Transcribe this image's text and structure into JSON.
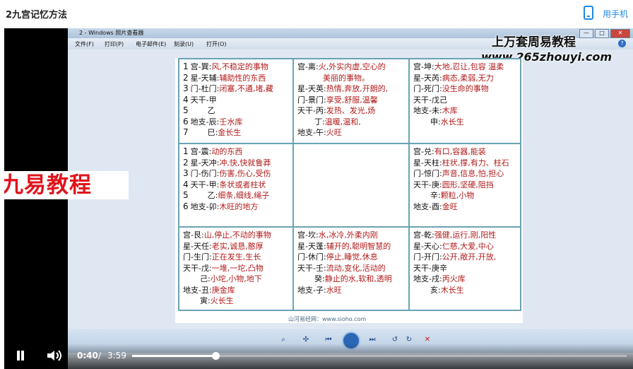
{
  "page": {
    "title": "2九宫记忆方法",
    "use_phone": "用手机"
  },
  "viewer": {
    "window_title": "2 - Windows 照片查看器",
    "menu": [
      "文件(F)",
      "打印(P)",
      "电子邮件(E)",
      "刻录(U)",
      "打开(O)"
    ],
    "controls": [
      "—",
      "□",
      "✕"
    ]
  },
  "watermark": {
    "title": "上万套周易教程",
    "url": "www.265zhouyi.com"
  },
  "brand": "九易教程",
  "doc_footer": "山河易经网：www.sioho.com",
  "palaces": [
    {
      "id": "xun",
      "lines": [
        {
          "n": "1",
          "k": "宫-巽",
          "v": "风,不稳定的事物"
        },
        {
          "n": "2",
          "k": "星-天辅",
          "v": "辅助性的东西"
        },
        {
          "n": "3",
          "k": "门-杜门",
          "v": "闭塞,不通,堵,藏"
        },
        {
          "n": "4",
          "k": "天干-甲",
          "v": ""
        },
        {
          "n": "5",
          "k": "乙",
          "v": ""
        },
        {
          "n": "6",
          "k": "地支-辰",
          "v": "壬水库"
        },
        {
          "n": "7",
          "k": "巳",
          "v": "金长生"
        }
      ]
    },
    {
      "id": "li",
      "lines": [
        {
          "n": "",
          "k": "宫-离",
          "v": "火,外实内虚,空心的"
        },
        {
          "n": "",
          "k": "",
          "v": "美丽的事物。"
        },
        {
          "n": "",
          "k": "星-天英",
          "v": "热情,奔放,开朗的,"
        },
        {
          "n": "",
          "k": "门-景门",
          "v": "享受,舒服,温馨"
        },
        {
          "n": "",
          "k": "天干-丙",
          "v": "发热、发光,炀"
        },
        {
          "n": "",
          "k": "丁",
          "v": "温暖,温和,"
        },
        {
          "n": "",
          "k": "地支-午",
          "v": "火旺"
        }
      ]
    },
    {
      "id": "kun",
      "lines": [
        {
          "n": "",
          "k": "宫-坤",
          "v": "大地,忍让,包容  温柔"
        },
        {
          "n": "",
          "k": "星-天芮",
          "v": "病态,柔弱,无力"
        },
        {
          "n": "",
          "k": "门-死门",
          "v": "没生命的事物"
        },
        {
          "n": "",
          "k": "天干-戊己",
          "v": ""
        },
        {
          "n": "",
          "k": "地支-未",
          "v": "木库"
        },
        {
          "n": "",
          "k": "申",
          "v": "水长生"
        }
      ]
    },
    {
      "id": "zhen",
      "lines": [
        {
          "n": "1",
          "k": "宫-震",
          "v": "动的东西"
        },
        {
          "n": "2",
          "k": "星-天冲",
          "v": "冲,快,快就鲁莽"
        },
        {
          "n": "3",
          "k": "门-伤门",
          "v": "伤害,伤心,受伤"
        },
        {
          "n": "4",
          "k": "天干-甲",
          "v": "条状或者柱状"
        },
        {
          "n": "5",
          "k": "乙",
          "v": "细条,细线,绳子"
        },
        {
          "n": "6",
          "k": "地支-卯",
          "v": "木旺的地方"
        }
      ]
    },
    {
      "id": "zhong",
      "lines": []
    },
    {
      "id": "dui",
      "lines": [
        {
          "n": "",
          "k": "宫-兑",
          "v": "有口,容器,能装"
        },
        {
          "n": "",
          "k": "星-天柱",
          "v": "柱状,撑,有力、柱石"
        },
        {
          "n": "",
          "k": "门-惊门",
          "v": "声音,信息,怕,担心"
        },
        {
          "n": "",
          "k": "天干-庚",
          "v": "圆形,坚硬,阻挡"
        },
        {
          "n": "",
          "k": "辛",
          "v": "颗粒,小物"
        },
        {
          "n": "",
          "k": "地支-酉",
          "v": "金旺"
        }
      ]
    },
    {
      "id": "gen",
      "lines": [
        {
          "n": "",
          "k": "宫-艮",
          "v": "山,停止,不动的事物"
        },
        {
          "n": "",
          "k": "星-天任",
          "v": "老实,诚恳,憨厚"
        },
        {
          "n": "",
          "k": "门-生门",
          "v": "正在发生,生长"
        },
        {
          "n": "",
          "k": "天干-戊",
          "v": "一堆,一坨,凸物"
        },
        {
          "n": "",
          "k": "己",
          "v": "小坨,小物,地下"
        },
        {
          "n": "",
          "k": "地支-丑",
          "v": "庚金库"
        },
        {
          "n": "",
          "k": "寅",
          "v": "火长生"
        }
      ]
    },
    {
      "id": "kan",
      "lines": [
        {
          "n": "",
          "k": "宫-坎",
          "v": "水,冰冷,外柔内刚"
        },
        {
          "n": "",
          "k": "星-天蓬",
          "v": "辅开的,聪明智慧的"
        },
        {
          "n": "",
          "k": "门-休门",
          "v": "停止,睡觉,休息"
        },
        {
          "n": "",
          "k": "天干-壬",
          "v": "流动,变化,活动的"
        },
        {
          "n": "",
          "k": "癸",
          "v": "静止的水,软和,透明"
        },
        {
          "n": "",
          "k": "地支-子",
          "v": "水旺"
        }
      ]
    },
    {
      "id": "qian",
      "lines": [
        {
          "n": "",
          "k": "宫-乾",
          "v": "强健,运行,刚,阳性"
        },
        {
          "n": "",
          "k": "星-天心",
          "v": "仁慈,大爱,中心"
        },
        {
          "n": "",
          "k": "门-开门",
          "v": "公开,敞开,开放,"
        },
        {
          "n": "",
          "k": "天干-庚辛",
          "v": ""
        },
        {
          "n": "",
          "k": "地支-戌",
          "v": "丙火库"
        },
        {
          "n": "",
          "k": "亥",
          "v": "木长生"
        }
      ]
    }
  ],
  "player": {
    "time_current": "0:40",
    "time_separator": "/",
    "time_total": "3:59",
    "progress": 0.168
  }
}
